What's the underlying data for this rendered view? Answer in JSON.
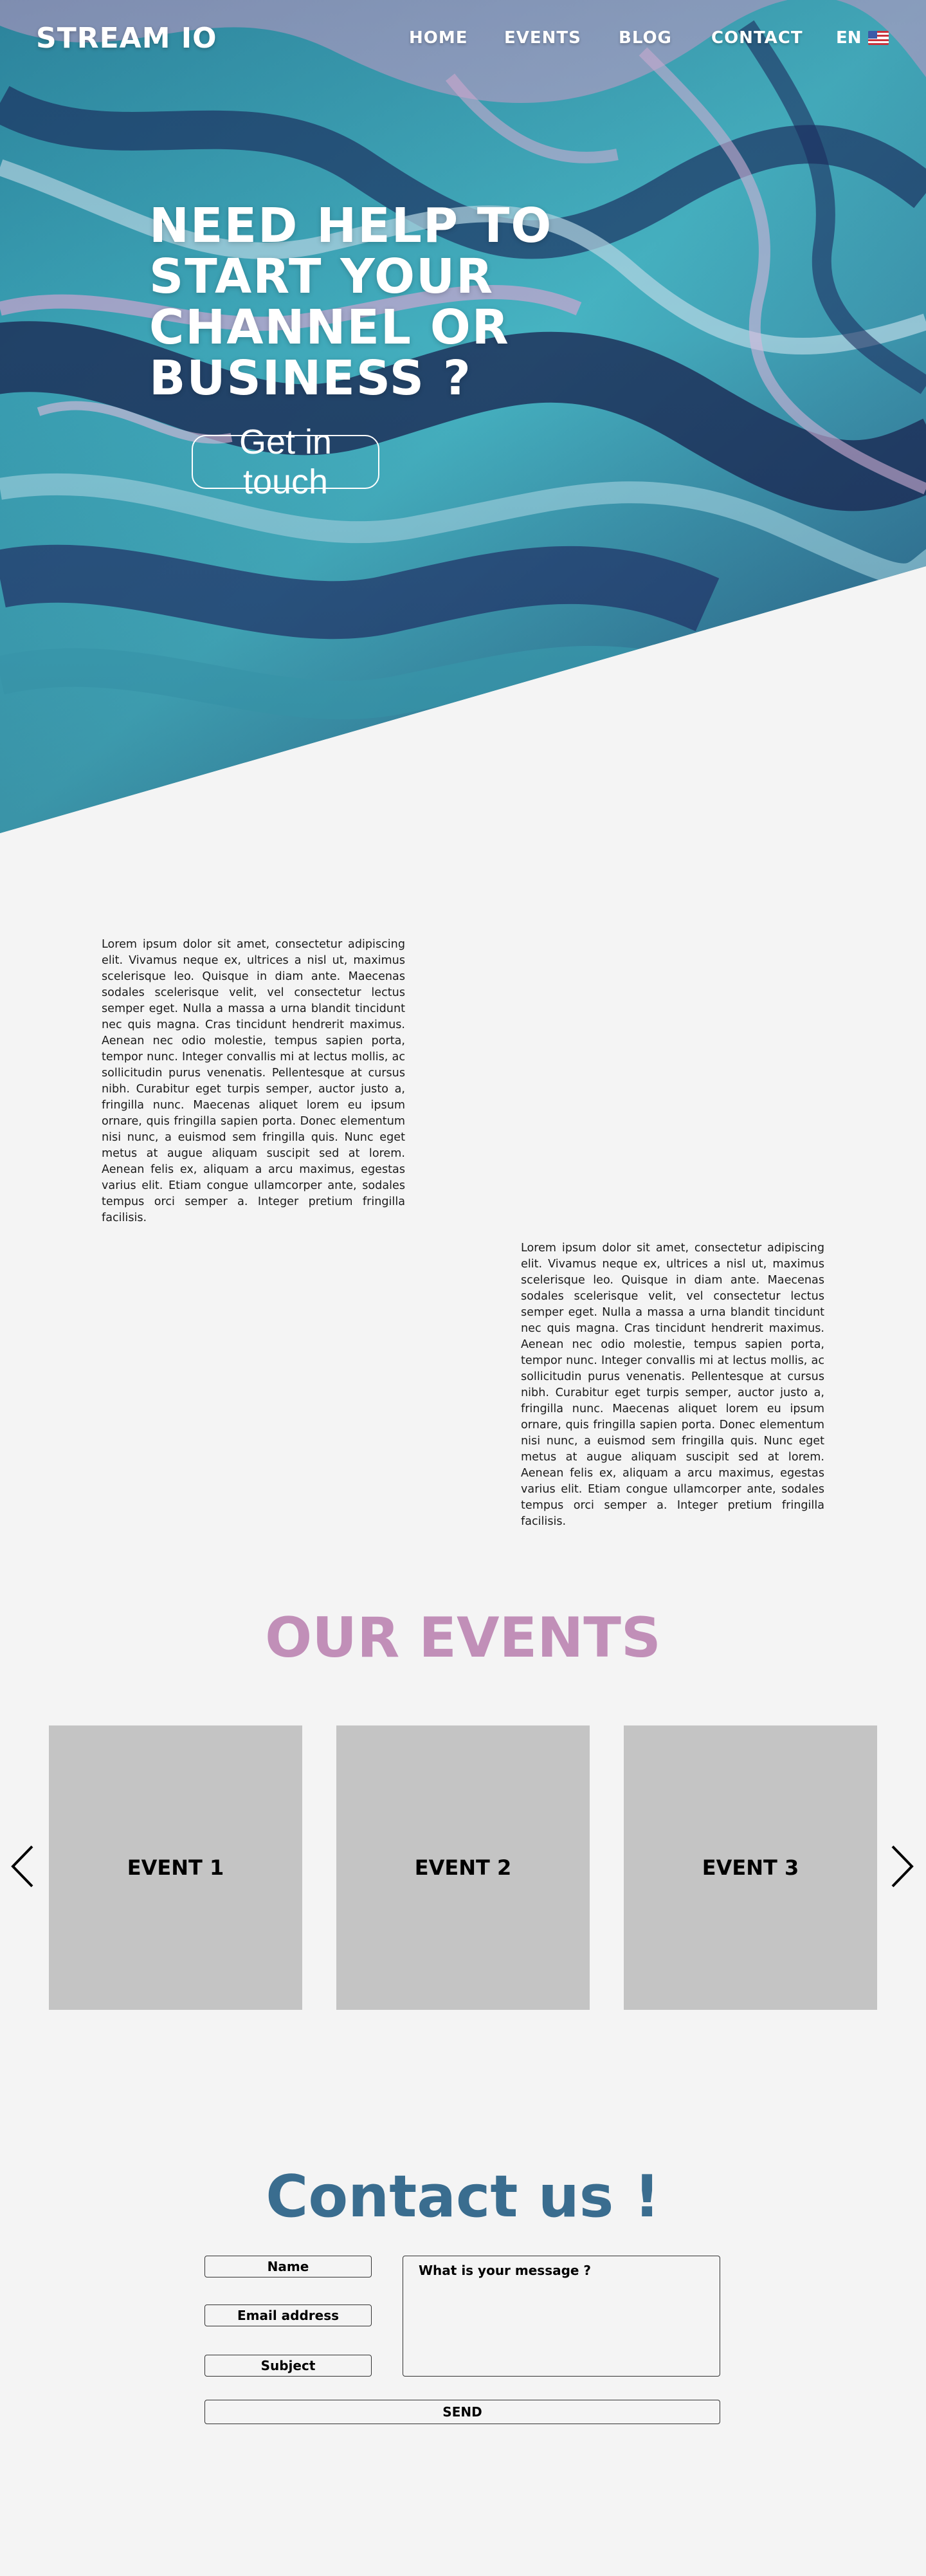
{
  "header": {
    "brand": "STREAM IO",
    "nav": [
      {
        "label": "HOME"
      },
      {
        "label": "EVENTS"
      },
      {
        "label": "BLOG"
      },
      {
        "label": "CONTACT"
      }
    ],
    "language": "EN"
  },
  "hero": {
    "title": "NEED HELP TO START YOUR CHANNEL OR BUSINESS ?",
    "cta_label": "Get in touch"
  },
  "content": {
    "paragraph_1": "Lorem ipsum dolor sit amet, consectetur adipiscing elit. Vivamus neque ex, ultrices a nisl ut, maximus scelerisque leo. Quisque in diam ante. Maecenas sodales scelerisque velit, vel consectetur lectus semper eget. Nulla a massa a urna blandit tincidunt nec quis magna. Cras tincidunt hendrerit maximus. Aenean nec odio molestie, tempus sapien porta, tempor nunc. Integer convallis mi at lectus mollis, ac sollicitudin purus venenatis. Pellentesque at cursus nibh. Curabitur eget turpis semper, auctor justo a, fringilla nunc. Maecenas aliquet lorem eu ipsum ornare, quis fringilla sapien porta. Donec elementum nisi nunc, a euismod sem fringilla quis. Nunc eget metus at augue aliquam suscipit sed at lorem. Aenean felis ex, aliquam a arcu maximus, egestas varius elit. Etiam congue ullamcorper ante, sodales tempus orci semper a. Integer pretium fringilla facilisis.",
    "paragraph_2": "Lorem ipsum dolor sit amet, consectetur adipiscing elit. Vivamus neque ex, ultrices a nisl ut, maximus scelerisque leo. Quisque in diam ante. Maecenas sodales scelerisque velit, vel consectetur lectus semper eget. Nulla a massa a urna blandit tincidunt nec quis magna. Cras tincidunt hendrerit maximus. Aenean nec odio molestie, tempus sapien porta, tempor nunc. Integer convallis mi at lectus mollis, ac sollicitudin purus venenatis. Pellentesque at cursus nibh. Curabitur eget turpis semper, auctor justo a, fringilla nunc. Maecenas aliquet lorem eu ipsum ornare, quis fringilla sapien porta. Donec elementum nisi nunc, a euismod sem fringilla quis. Nunc eget metus at augue aliquam suscipit sed at lorem. Aenean felis ex, aliquam a arcu maximus, egestas varius elit. Etiam congue ullamcorper ante, sodales tempus orci semper a. Integer pretium fringilla facilisis."
  },
  "events": {
    "title": "OUR EVENTS",
    "cards": [
      {
        "label": "EVENT 1"
      },
      {
        "label": "EVENT 2"
      },
      {
        "label": "EVENT 3"
      }
    ],
    "prev_icon": "chevron-left-icon",
    "next_icon": "chevron-right-icon"
  },
  "contact": {
    "title": "Contact us !",
    "name_placeholder": "Name",
    "email_placeholder": "Email address",
    "subject_placeholder": "Subject",
    "message_placeholder": "What is your message ?",
    "send_label": "SEND"
  },
  "colors": {
    "page_background": "#f4f4f4",
    "events_title": "#c18fb8",
    "contact_title": "#3a6d8f",
    "event_card": "#c4c4c4"
  }
}
